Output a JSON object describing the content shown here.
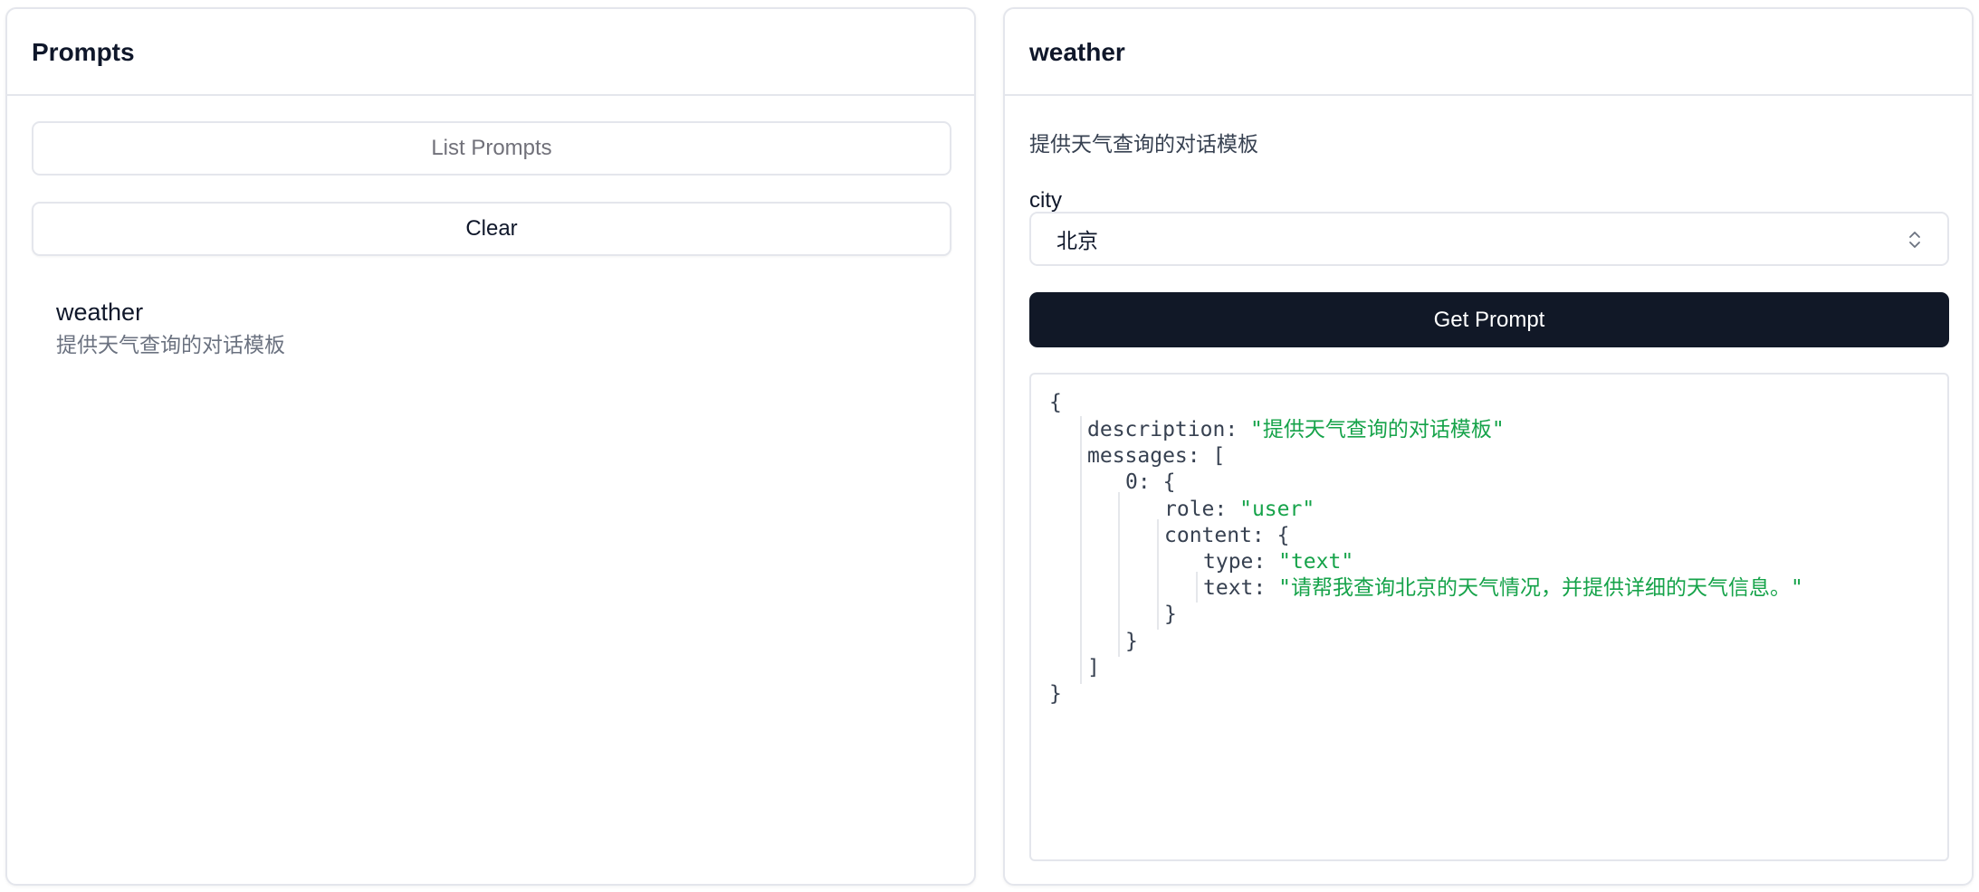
{
  "left": {
    "title": "Prompts",
    "list_button": "List Prompts",
    "clear_button": "Clear",
    "items": [
      {
        "name": "weather",
        "description": "提供天气查询的对话模板"
      }
    ]
  },
  "right": {
    "title": "weather",
    "description": "提供天气查询的对话模板",
    "field_label": "city",
    "field_value": "北京",
    "submit_button": "Get Prompt",
    "result": {
      "open_brace": "{",
      "description_key": "description:",
      "description_value": "\"提供天气查询的对话模板\"",
      "messages_key": "messages:",
      "open_bracket": "[",
      "index_key": "0:",
      "obj_open": "{",
      "role_key": "role:",
      "role_value": "\"user\"",
      "content_key": "content:",
      "content_open": "{",
      "type_key": "type:",
      "type_value": "\"text\"",
      "text_key": "text:",
      "text_value": "\"请帮我查询北京的天气情况，并提供详细的天气信息。\"",
      "content_close": "}",
      "obj_close": "}",
      "close_bracket": "]",
      "close_brace": "}"
    }
  },
  "colors": {
    "border": "#e4e6ec",
    "primary": "#111827",
    "string": "#16a34a",
    "muted": "#6b7280"
  }
}
